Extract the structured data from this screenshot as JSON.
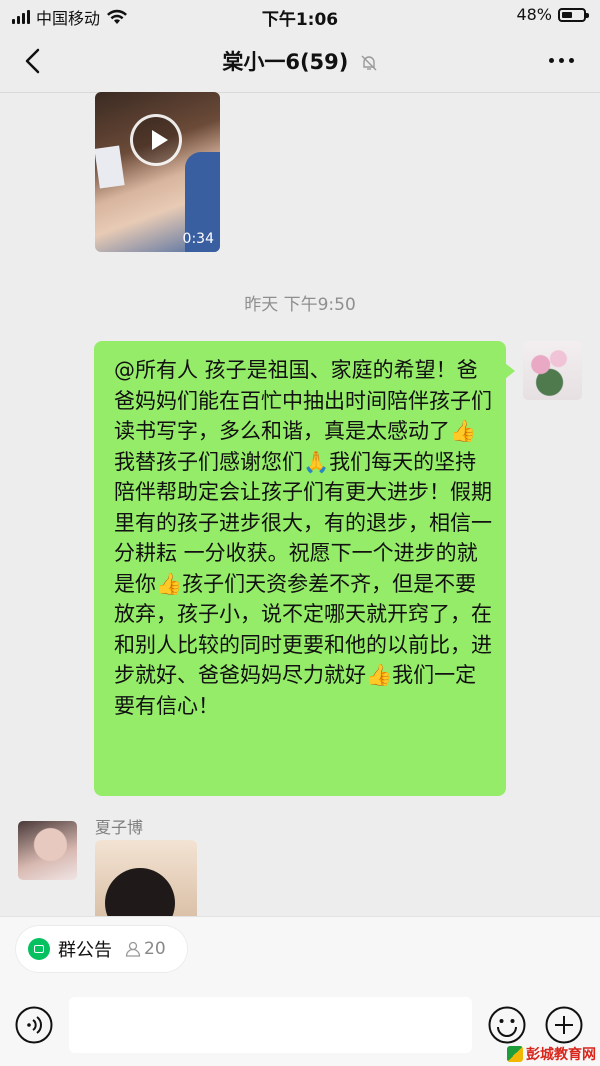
{
  "status_bar": {
    "carrier": "中国移动",
    "time": "下午1:06",
    "battery": "48%"
  },
  "nav": {
    "title": "棠小一6(59)"
  },
  "video": {
    "duration": "0:34"
  },
  "timestamp": "昨天 下午9:50",
  "my_message": "@所有人 孩子是祖国、家庭的希望！爸爸妈妈们能在百忙中抽出时间陪伴孩子们读书写字，多么和谐，真是太感动了👍我替孩子们感谢您们🙏我们每天的坚持陪伴帮助定会让孩子们有更大进步！假期里有的孩子进步很大，有的退步，相信一分耕耘 一分收获。祝愿下一个进步的就是你👍孩子们天资参差不齐，但是不要放弃，孩子小，说不定哪天就开窍了，在和别人比较的同时更要和他的以前比，进步就好、爸爸妈妈尽力就好👍我们一定要有信心！",
  "other_message": {
    "sender": "夏子博"
  },
  "announcement": {
    "label": "群公告",
    "count": "20"
  },
  "input": {
    "value": ""
  },
  "watermark": {
    "text": "彭城教育网"
  },
  "colors": {
    "background": "#ededed",
    "my_bubble": "#95ec69",
    "accent_green": "#07c160"
  }
}
